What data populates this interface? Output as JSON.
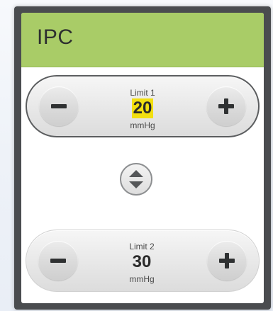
{
  "panel": {
    "title": "IPC",
    "header_color": "#a9cc67"
  },
  "limit1": {
    "label": "Limit 1",
    "value": "20",
    "unit": "mmHg",
    "selected": true,
    "highlight_color": "#f2df10"
  },
  "limit2": {
    "label": "Limit 2",
    "value": "30",
    "unit": "mmHg",
    "selected": false
  },
  "icons": {
    "decrement": "minus-icon",
    "increment": "plus-icon",
    "swap": "up-down-arrows-icon"
  }
}
